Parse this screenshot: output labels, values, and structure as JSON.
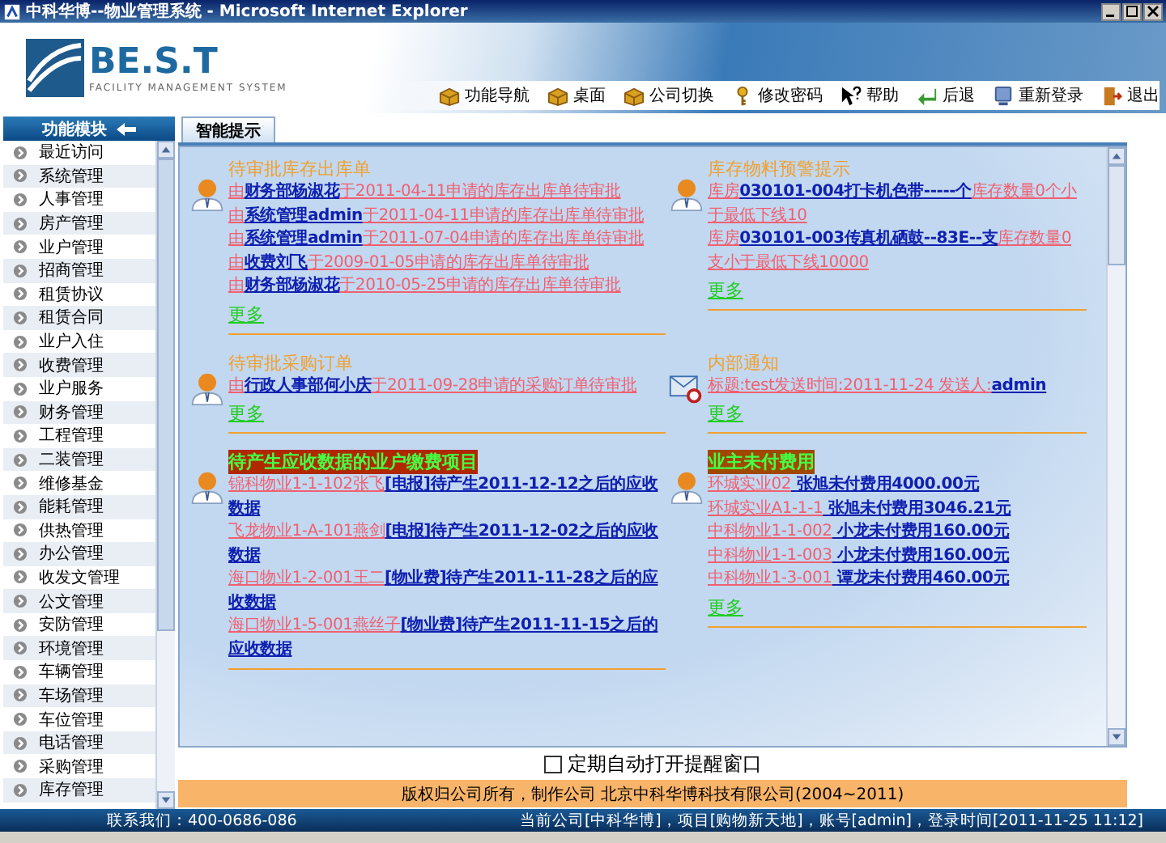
{
  "window": {
    "title": "中科华博--物业管理系统 - Microsoft Internet Explorer"
  },
  "header": {
    "logo": "BE.S.T",
    "tagline": "FACILITY MANAGEMENT SYSTEM",
    "toolbar": [
      {
        "kind": "nav",
        "label": "功能导航"
      },
      {
        "kind": "desktop",
        "label": "桌面"
      },
      {
        "kind": "switch",
        "label": "公司切换"
      },
      {
        "kind": "password",
        "label": "修改密码"
      },
      {
        "kind": "help",
        "label": "帮助"
      },
      {
        "kind": "back",
        "label": "后退"
      },
      {
        "kind": "relogin",
        "label": "重新登录"
      },
      {
        "kind": "exit",
        "label": "退出"
      }
    ]
  },
  "sidebar": {
    "title": "功能模块",
    "items": [
      "最近访问",
      "系统管理",
      "人事管理",
      "房产管理",
      "业户管理",
      "招商管理",
      "租赁协议",
      "租赁合同",
      "业户入住",
      "收费管理",
      "业户服务",
      "财务管理",
      "工程管理",
      "二装管理",
      "维修基金",
      "能耗管理",
      "供热管理",
      "办公管理",
      "收发文管理",
      "公文管理",
      "安防管理",
      "环境管理",
      "车辆管理",
      "车场管理",
      "车位管理",
      "电话管理",
      "采购管理",
      "库存管理"
    ]
  },
  "tabs": [
    {
      "label": "智能提示",
      "selected": true
    }
  ],
  "sections": [
    {
      "kind": "task",
      "title": "待审批库存出库单",
      "highlighted": false,
      "more": "更多",
      "lines": [
        [
          {
            "kind": "plain",
            "text": "由"
          },
          {
            "kind": "link",
            "text": "财务部杨淑花"
          },
          {
            "kind": "plain",
            "text": "于2011-04-11申请的库存出库单待审批"
          }
        ],
        [
          {
            "kind": "plain",
            "text": "由"
          },
          {
            "kind": "link",
            "text": "系统管理admin"
          },
          {
            "kind": "plain",
            "text": "于2011-04-11申请的库存出库单待审批"
          }
        ],
        [
          {
            "kind": "plain",
            "text": "由"
          },
          {
            "kind": "link",
            "text": "系统管理admin"
          },
          {
            "kind": "plain",
            "text": "于2011-07-04申请的库存出库单待审批"
          }
        ],
        [
          {
            "kind": "plain",
            "text": "由"
          },
          {
            "kind": "link",
            "text": "收费刘飞"
          },
          {
            "kind": "plain",
            "text": "于2009-01-05申请的库存出库单待审批"
          }
        ],
        [
          {
            "kind": "plain",
            "text": "由"
          },
          {
            "kind": "link",
            "text": "财务部杨淑花"
          },
          {
            "kind": "plain",
            "text": "于2010-05-25申请的库存出库单待审批"
          }
        ]
      ]
    },
    {
      "kind": "task",
      "title": "库存物料预警提示",
      "highlighted": false,
      "more": "更多",
      "lines": [
        [
          {
            "kind": "plain",
            "text": "库房"
          },
          {
            "kind": "link",
            "text": "030101-004打卡机色带-----个"
          },
          {
            "kind": "plain",
            "text": "库存数量0个小于最低下线10"
          }
        ],
        [
          {
            "kind": "plain",
            "text": "库房"
          },
          {
            "kind": "link",
            "text": "030101-003传真机硒鼓--83E--支"
          },
          {
            "kind": "plain",
            "text": "库存数量0支小于最低下线10000"
          }
        ]
      ]
    },
    {
      "kind": "task",
      "title": "待审批采购订单",
      "highlighted": false,
      "more": "更多",
      "lines": [
        [
          {
            "kind": "plain",
            "text": "由"
          },
          {
            "kind": "link",
            "text": "行政人事部何小庆"
          },
          {
            "kind": "plain",
            "text": "于2011-09-28申请的采购订单待审批"
          }
        ]
      ]
    },
    {
      "kind": "notice",
      "title": "内部通知",
      "highlighted": false,
      "more": "更多",
      "lines": [
        [
          {
            "kind": "plain",
            "text": "标题:test发送时间:2011-11-24 发送人:"
          },
          {
            "kind": "link",
            "text": "admin"
          }
        ]
      ]
    },
    {
      "kind": "task",
      "title": "待产生应收数据的业户缴费项目",
      "highlighted": true,
      "lines": [
        [
          {
            "kind": "plain",
            "text": "锦科物业1-1-102张飞"
          },
          {
            "kind": "link",
            "text": "[电报]待产生2011-12-12之后的应收数据"
          }
        ],
        [
          {
            "kind": "plain",
            "text": "飞龙物业1-A-101燕剑"
          },
          {
            "kind": "link",
            "text": "[电报]待产生2011-12-02之后的应收数据"
          }
        ],
        [
          {
            "kind": "plain",
            "text": "海口物业1-2-001王二"
          },
          {
            "kind": "link",
            "text": "[物业费]待产生2011-11-28之后的应收数据"
          }
        ],
        [
          {
            "kind": "plain",
            "text": "海口物业1-5-001燕丝子"
          },
          {
            "kind": "link",
            "text": "[物业费]待产生2011-11-15之后的应收数据"
          }
        ]
      ]
    },
    {
      "kind": "task",
      "title": "业主未付费用",
      "highlighted": true,
      "more": "更多",
      "lines": [
        [
          {
            "kind": "plain",
            "text": "环城实业02"
          },
          {
            "kind": "link",
            "text": " 张旭未付费用4000.00元"
          }
        ],
        [
          {
            "kind": "plain",
            "text": "环城实业A1-1-1"
          },
          {
            "kind": "link",
            "text": " 张旭未付费用3046.21元"
          }
        ],
        [
          {
            "kind": "plain",
            "text": "中科物业1-1-002"
          },
          {
            "kind": "link",
            "text": " 小龙未付费用160.00元"
          }
        ],
        [
          {
            "kind": "plain",
            "text": "中科物业1-1-003"
          },
          {
            "kind": "link",
            "text": " 小龙未付费用160.00元"
          }
        ],
        [
          {
            "kind": "plain",
            "text": "中科物业1-3-001"
          },
          {
            "kind": "link",
            "text": " 谭龙未付费用460.00元"
          }
        ]
      ]
    }
  ],
  "auto_open": {
    "label": "定期自动打开提醒窗口",
    "checked": false
  },
  "copyright": "版权归公司所有，制作公司 北京中科华博科技有限公司(2004~2011)",
  "status_bar": {
    "contact": "联系我们：400-0686-086",
    "session": "当前公司[中科华博]，项目[购物新天地]，账号[admin]，登录时间[2011-11-25 11:12]"
  }
}
